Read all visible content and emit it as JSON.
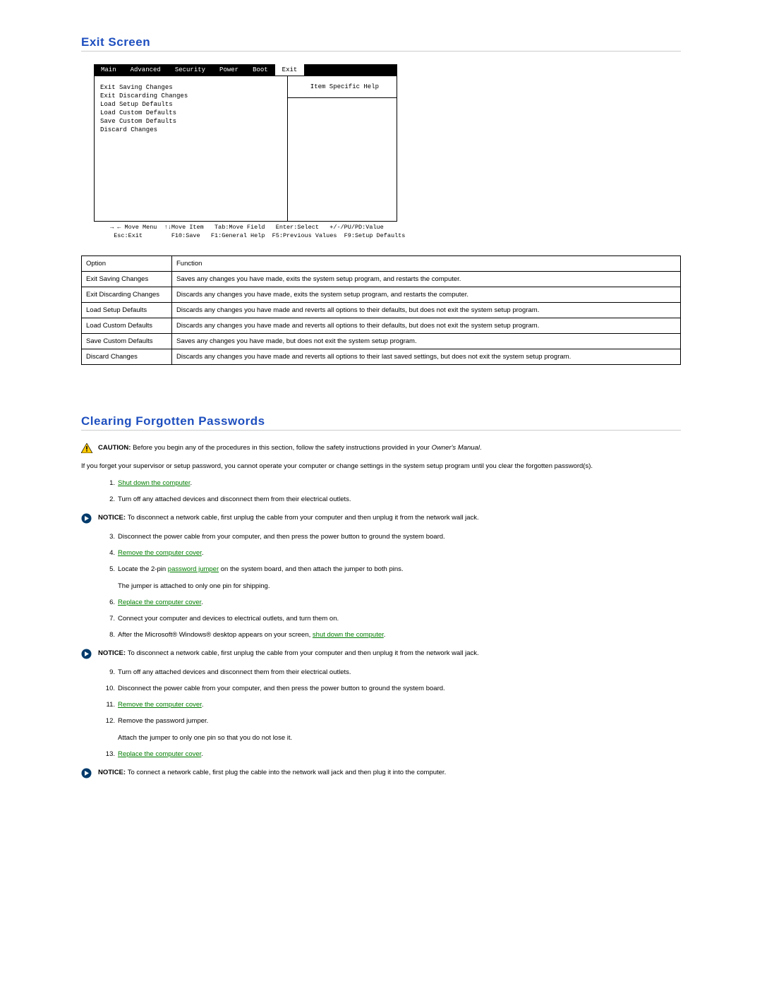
{
  "section1_title": "Exit Screen",
  "bios": {
    "tabs": [
      "Main",
      "Advanced",
      "Security",
      "Power",
      "Boot",
      "Exit"
    ],
    "inverted_tab": "Exit",
    "left_items": [
      "Exit Saving Changes",
      "Exit Discarding Changes",
      "Load Setup Defaults",
      "Load Custom Defaults",
      "Save Custom Defaults",
      "Discard Changes"
    ],
    "right_head": "Item Specific Help",
    "foot_line1": " → ← Move Menu  ↑↓Move Item   Tab:Move Field   Enter:Select   +/-/PU/PD:Value",
    "foot_line2": "  Esc:Exit        F10:Save   F1:General Help  F5:Previous Values  F9:Setup Defaults"
  },
  "opts_header_option": "Option",
  "opts_header_function": "Function",
  "opts_rows": [
    {
      "opt": "Exit Saving Changes",
      "fn": "Saves any changes you have made, exits the system setup program, and restarts the computer."
    },
    {
      "opt": "Exit Discarding Changes",
      "fn": "Discards any changes you have made, exits the system setup program, and restarts the computer."
    },
    {
      "opt": "Load Setup Defaults",
      "fn": "Discards any changes you have made and reverts all options to their defaults, but does not exit the system setup program."
    },
    {
      "opt": "Load Custom Defaults",
      "fn": "Discards any changes you have made and reverts all options to their defaults, but does not exit the system setup program."
    },
    {
      "opt": "Save Custom Defaults",
      "fn": "Saves any changes you have made, but does not exit the system setup program."
    },
    {
      "opt": "Discard Changes",
      "fn": "Discards any changes you have made and reverts all options to their last saved settings, but does not exit the system setup program."
    }
  ],
  "section2_title": "Clearing Forgotten Passwords",
  "caution_lead": "CAUTION: ",
  "caution_text_a": "Before you begin any of the procedures in this section, follow the safety instructions provided in your ",
  "caution_text_b": "Owner's Manual",
  "caution_text_c": ".",
  "intro_para": "If you forget your supervisor or setup password, you cannot operate your computer or change settings in the system setup program until you clear the forgotten password(s).",
  "steps_block1": {
    "s1_link": "Shut down the computer",
    "s1_tail": ".",
    "s2": "Turn off any attached devices and disconnect them from their electrical outlets."
  },
  "notice1_lead": "NOTICE: ",
  "notice1_text": "To disconnect a network cable, first unplug the cable from your computer and then unplug it from the network wall jack.",
  "steps_block2": {
    "s3": "Disconnect the power cable from your computer, and then press the power button to ground the system board.",
    "s4_link": "Remove the computer cover",
    "s4_tail": ".",
    "s5_a": "Locate the 2-pin ",
    "s5_link": "password jumper",
    "s5_b": " on the system board, and then attach the jumper to both pins.",
    "s5_sub": "The jumper is attached to only one pin for shipping.",
    "s6_link": "Replace the computer cover",
    "s6_tail": ".",
    "s7": "Connect your computer and devices to electrical outlets, and turn them on.",
    "s8_a": "After the Microsoft® Windows® desktop appears on your screen, ",
    "s8_link": "shut down the computer",
    "s8_tail": "."
  },
  "notice2_lead": "NOTICE: ",
  "notice2_text": "To disconnect a network cable, first unplug the cable from your computer and then unplug it from the network wall jack.",
  "steps_block3": {
    "s9": "Turn off any attached devices and disconnect them from their electrical outlets.",
    "s10": "Disconnect the power cable from your computer, and then press the power button to ground the system board.",
    "s11_link": "Remove the computer cover",
    "s11_tail": ".",
    "s12": "Remove the password jumper.",
    "s12_sub": "Attach the jumper to only one pin so that you do not lose it.",
    "s13_link": "Replace the computer cover",
    "s13_tail": "."
  },
  "notice3_lead": "NOTICE: ",
  "notice3_text": "To connect a network cable, first plug the cable into the network wall jack and then plug it into the computer."
}
